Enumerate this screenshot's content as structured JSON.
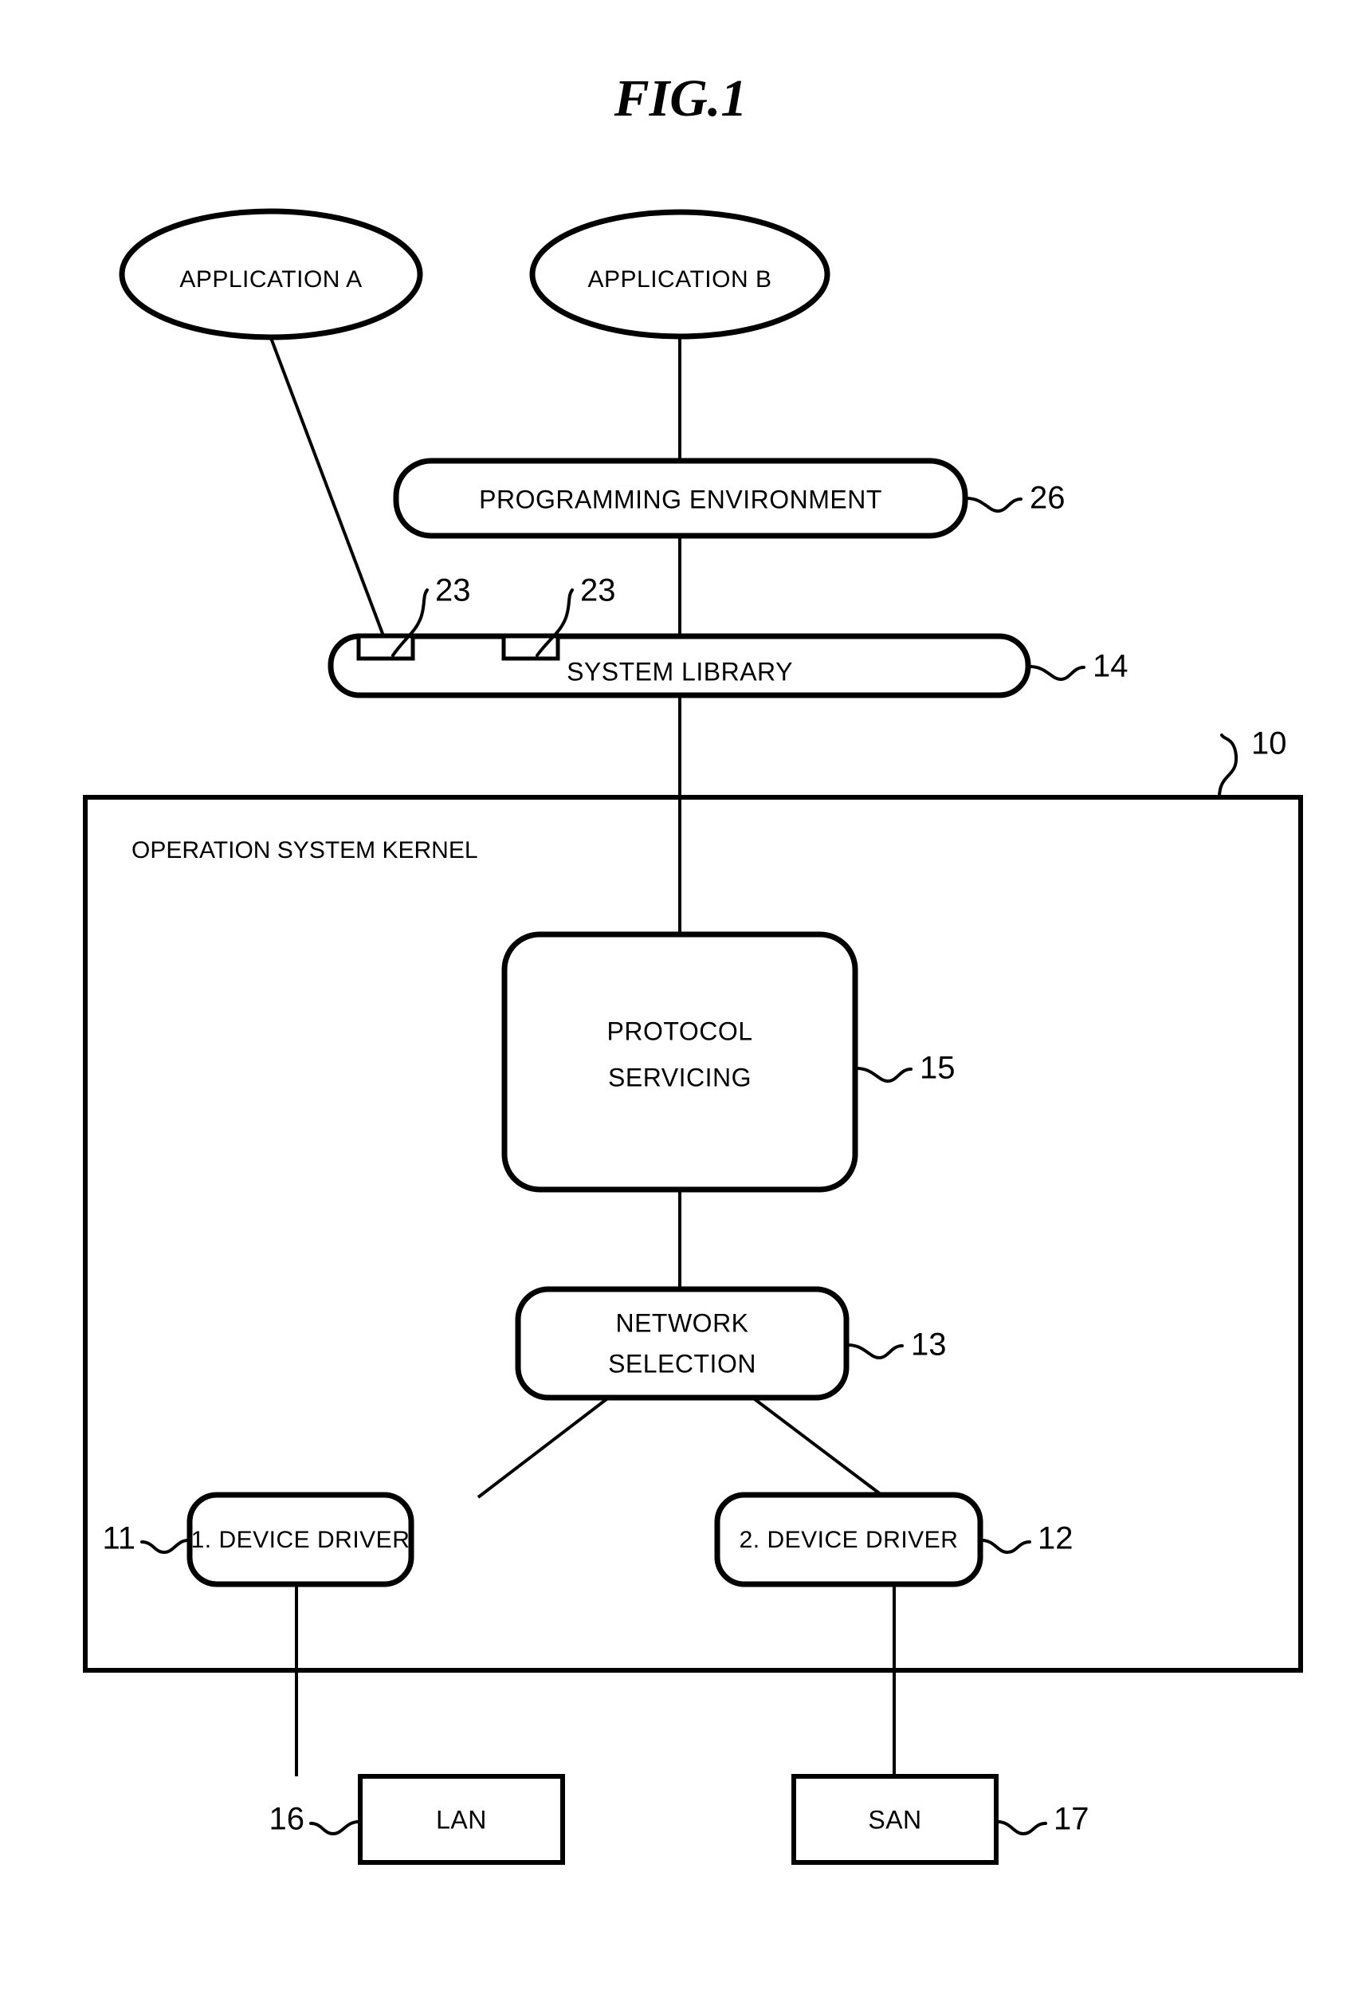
{
  "figure": {
    "title": "FIG.1",
    "diagram_type": "block-diagram",
    "description": "Patent figure block diagram of an operating system network stack"
  },
  "nodes": {
    "application_a": {
      "label": "APPLICATION A",
      "shape": "ellipse"
    },
    "application_b": {
      "label": "APPLICATION B",
      "shape": "ellipse"
    },
    "programming_environment": {
      "label": "PROGRAMMING ENVIRONMENT",
      "shape": "rounded-rect",
      "ref": "26"
    },
    "system_library": {
      "label": "SYSTEM LIBRARY",
      "shape": "rounded-rect",
      "ref": "14"
    },
    "interface_1": {
      "label": "",
      "shape": "notch",
      "ref": "23"
    },
    "interface_2": {
      "label": "",
      "shape": "notch",
      "ref": "23"
    },
    "os_kernel": {
      "label": "OPERATION SYSTEM KERNEL",
      "shape": "rect",
      "ref": "10"
    },
    "protocol_servicing": {
      "label_line1": "PROTOCOL",
      "label_line2": "SERVICING",
      "shape": "rounded-rect",
      "ref": "15"
    },
    "network_selection": {
      "label_line1": "NETWORK",
      "label_line2": "SELECTION",
      "shape": "rounded-rect",
      "ref": "13"
    },
    "device_driver_1": {
      "label": "1. DEVICE DRIVER",
      "shape": "rounded-rect",
      "ref": "11"
    },
    "device_driver_2": {
      "label": "2. DEVICE DRIVER",
      "shape": "rounded-rect",
      "ref": "12"
    },
    "lan": {
      "label": "LAN",
      "shape": "rect",
      "ref": "16"
    },
    "san": {
      "label": "SAN",
      "shape": "rect",
      "ref": "17"
    }
  },
  "reference_numerals": {
    "n10": "10",
    "n11": "11",
    "n12": "12",
    "n13": "13",
    "n14": "14",
    "n15": "15",
    "n16": "16",
    "n17": "17",
    "n23_left": "23",
    "n23_right": "23",
    "n26": "26"
  },
  "colors": {
    "line": "#000000",
    "fill": "#ffffff",
    "text": "#000000"
  }
}
